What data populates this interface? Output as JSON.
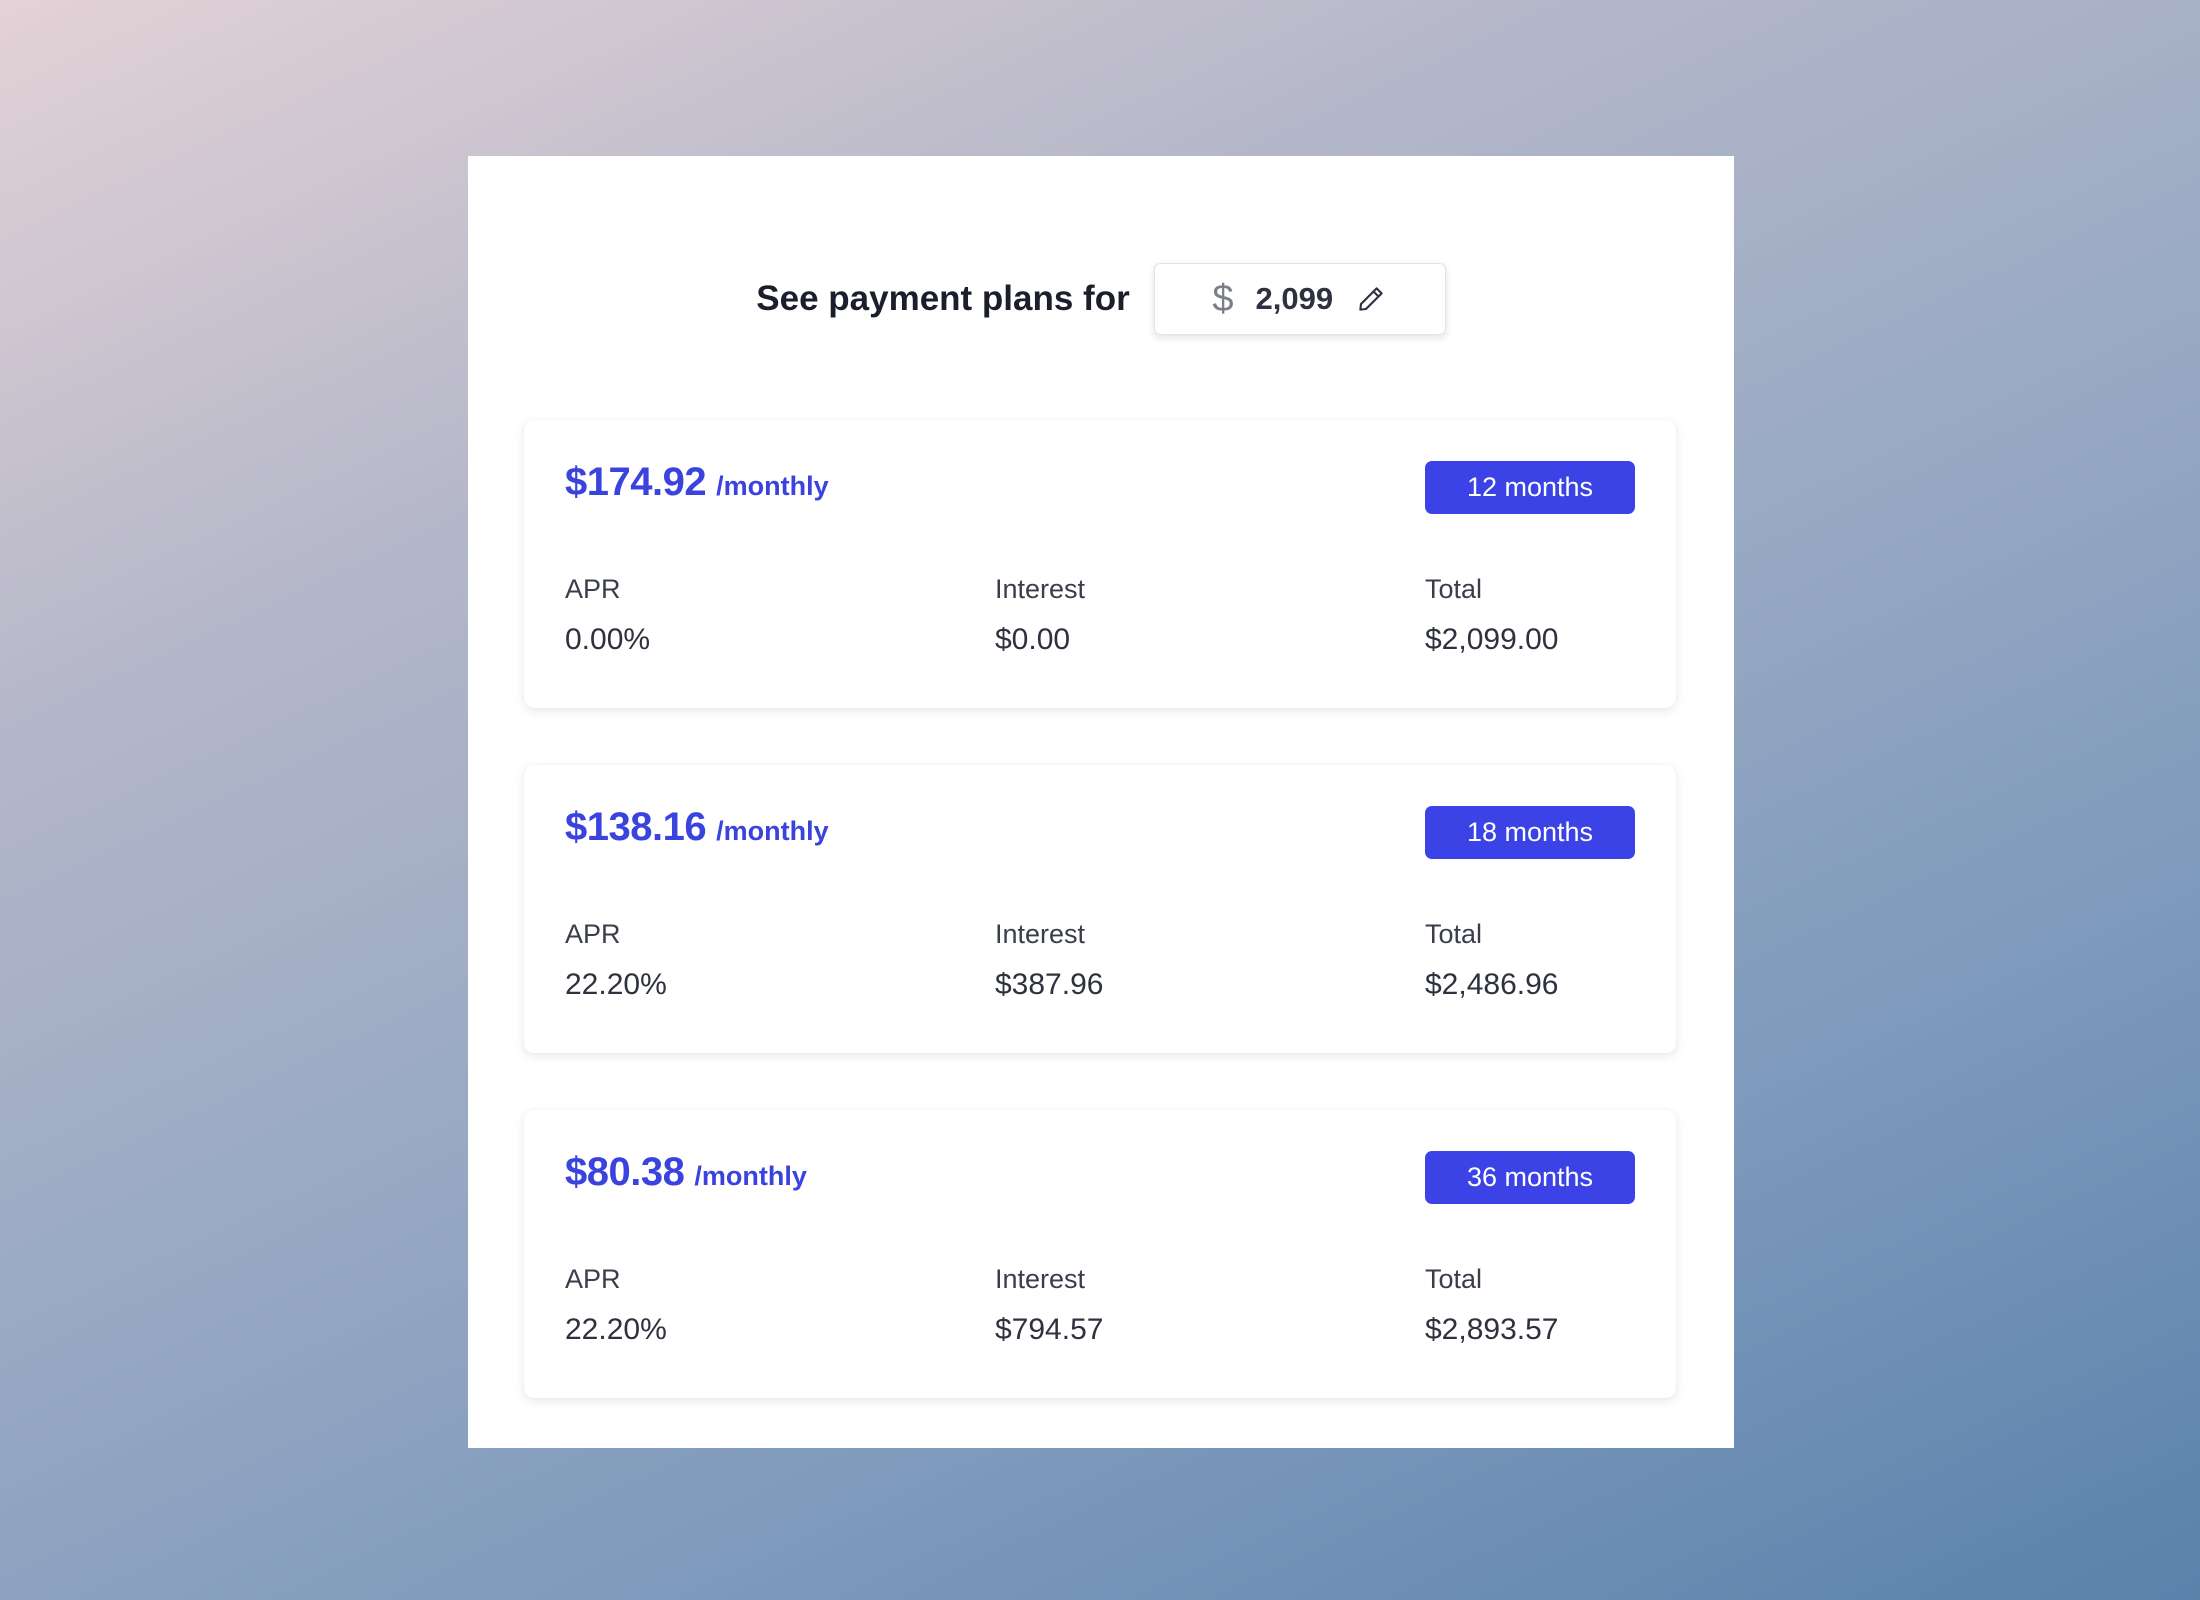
{
  "header": {
    "title": "See payment plans for",
    "currency_symbol": "$",
    "amount": "2,099",
    "edit_icon": "pencil-icon"
  },
  "colors": {
    "accent": "#3b43e6",
    "text_dark": "#1b1f2b"
  },
  "plans": [
    {
      "monthly_price": "$174.92",
      "per_label": "/monthly",
      "term": "12 months",
      "apr_label": "APR",
      "apr": "0.00%",
      "interest_label": "Interest",
      "interest": "$0.00",
      "total_label": "Total",
      "total": "$2,099.00"
    },
    {
      "monthly_price": "$138.16",
      "per_label": "/monthly",
      "term": "18 months",
      "apr_label": "APR",
      "apr": "22.20%",
      "interest_label": "Interest",
      "interest": "$387.96",
      "total_label": "Total",
      "total": "$2,486.96"
    },
    {
      "monthly_price": "$80.38",
      "per_label": "/monthly",
      "term": "36 months",
      "apr_label": "APR",
      "apr": "22.20%",
      "interest_label": "Interest",
      "interest": "$794.57",
      "total_label": "Total",
      "total": "$2,893.57"
    }
  ]
}
